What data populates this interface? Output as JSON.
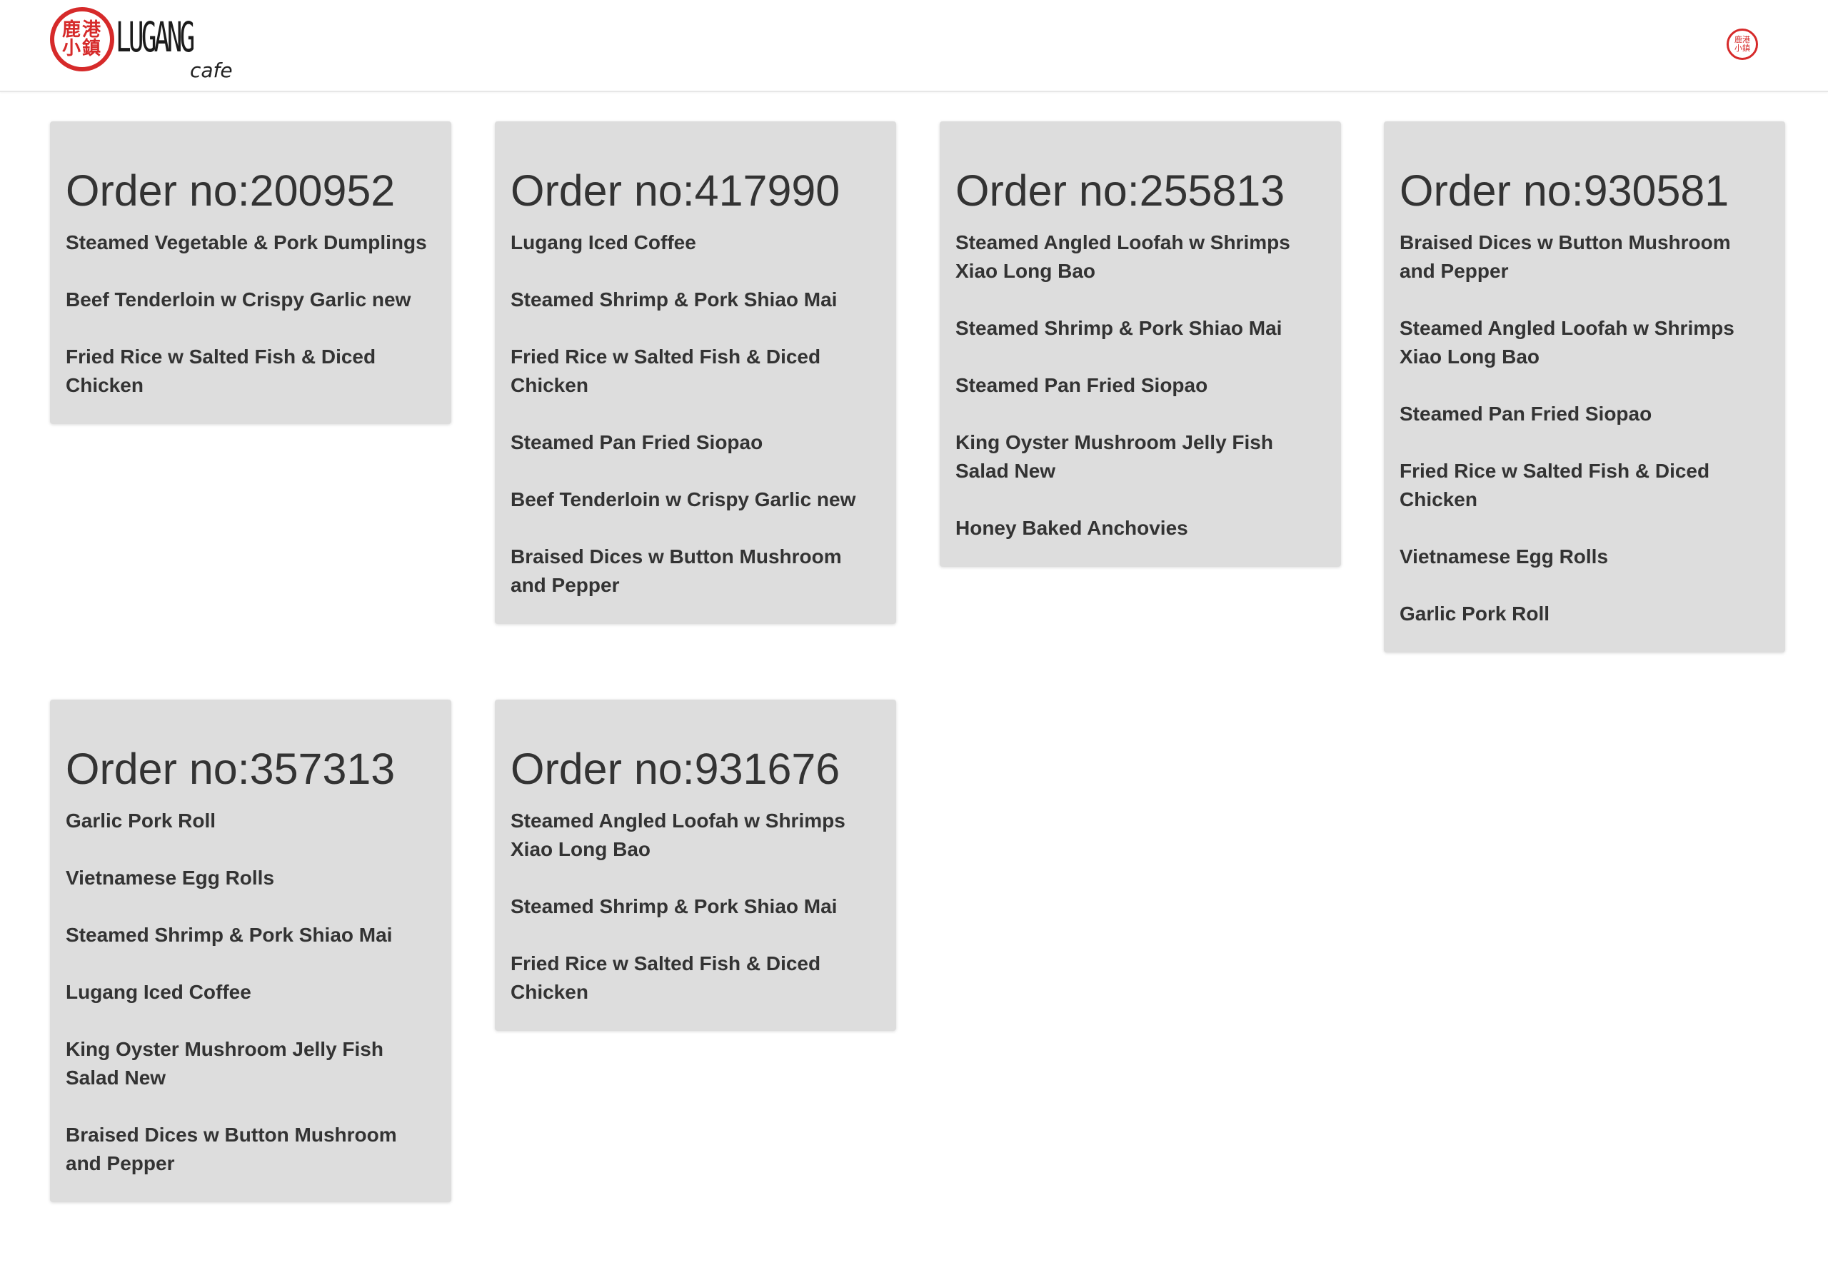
{
  "header": {
    "logo_chars": "鹿港小鎮",
    "logo_word": "LUGANG",
    "logo_sub": "cafe",
    "icon_chars": "鹿港小鎮"
  },
  "orders": [
    {
      "title": "Order no:200952",
      "items": [
        "Steamed Vegetable & Pork Dumplings",
        "Beef Tenderloin w Crispy Garlic new",
        "Fried Rice w Salted Fish & Diced Chicken"
      ]
    },
    {
      "title": "Order no:417990",
      "items": [
        "Lugang Iced Coffee",
        "Steamed Shrimp & Pork Shiao Mai",
        "Fried Rice w Salted Fish & Diced Chicken",
        "Steamed Pan Fried Siopao",
        "Beef Tenderloin w Crispy Garlic new",
        "Braised Dices w Button Mushroom and Pepper"
      ]
    },
    {
      "title": "Order no:255813",
      "items": [
        "Steamed Angled Loofah w Shrimps Xiao Long Bao",
        "Steamed Shrimp & Pork Shiao Mai",
        "Steamed Pan Fried Siopao",
        "King Oyster Mushroom Jelly Fish Salad New",
        "Honey Baked Anchovies"
      ]
    },
    {
      "title": "Order no:930581",
      "items": [
        "Braised Dices w Button Mushroom and Pepper",
        "Steamed Angled Loofah w Shrimps Xiao Long Bao",
        "Steamed Pan Fried Siopao",
        "Fried Rice w Salted Fish & Diced Chicken",
        "Vietnamese Egg Rolls",
        "Garlic Pork Roll"
      ]
    },
    {
      "title": "Order no:357313",
      "items": [
        "Garlic Pork Roll",
        "Vietnamese Egg Rolls",
        "Steamed Shrimp & Pork Shiao Mai",
        "Lugang Iced Coffee",
        "King Oyster Mushroom Jelly Fish Salad New",
        "Braised Dices w Button Mushroom and Pepper"
      ]
    },
    {
      "title": "Order no:931676",
      "items": [
        "Steamed Angled Loofah w Shrimps Xiao Long Bao",
        "Steamed Shrimp & Pork Shiao Mai",
        "Fried Rice w Salted Fish & Diced Chicken"
      ]
    }
  ]
}
